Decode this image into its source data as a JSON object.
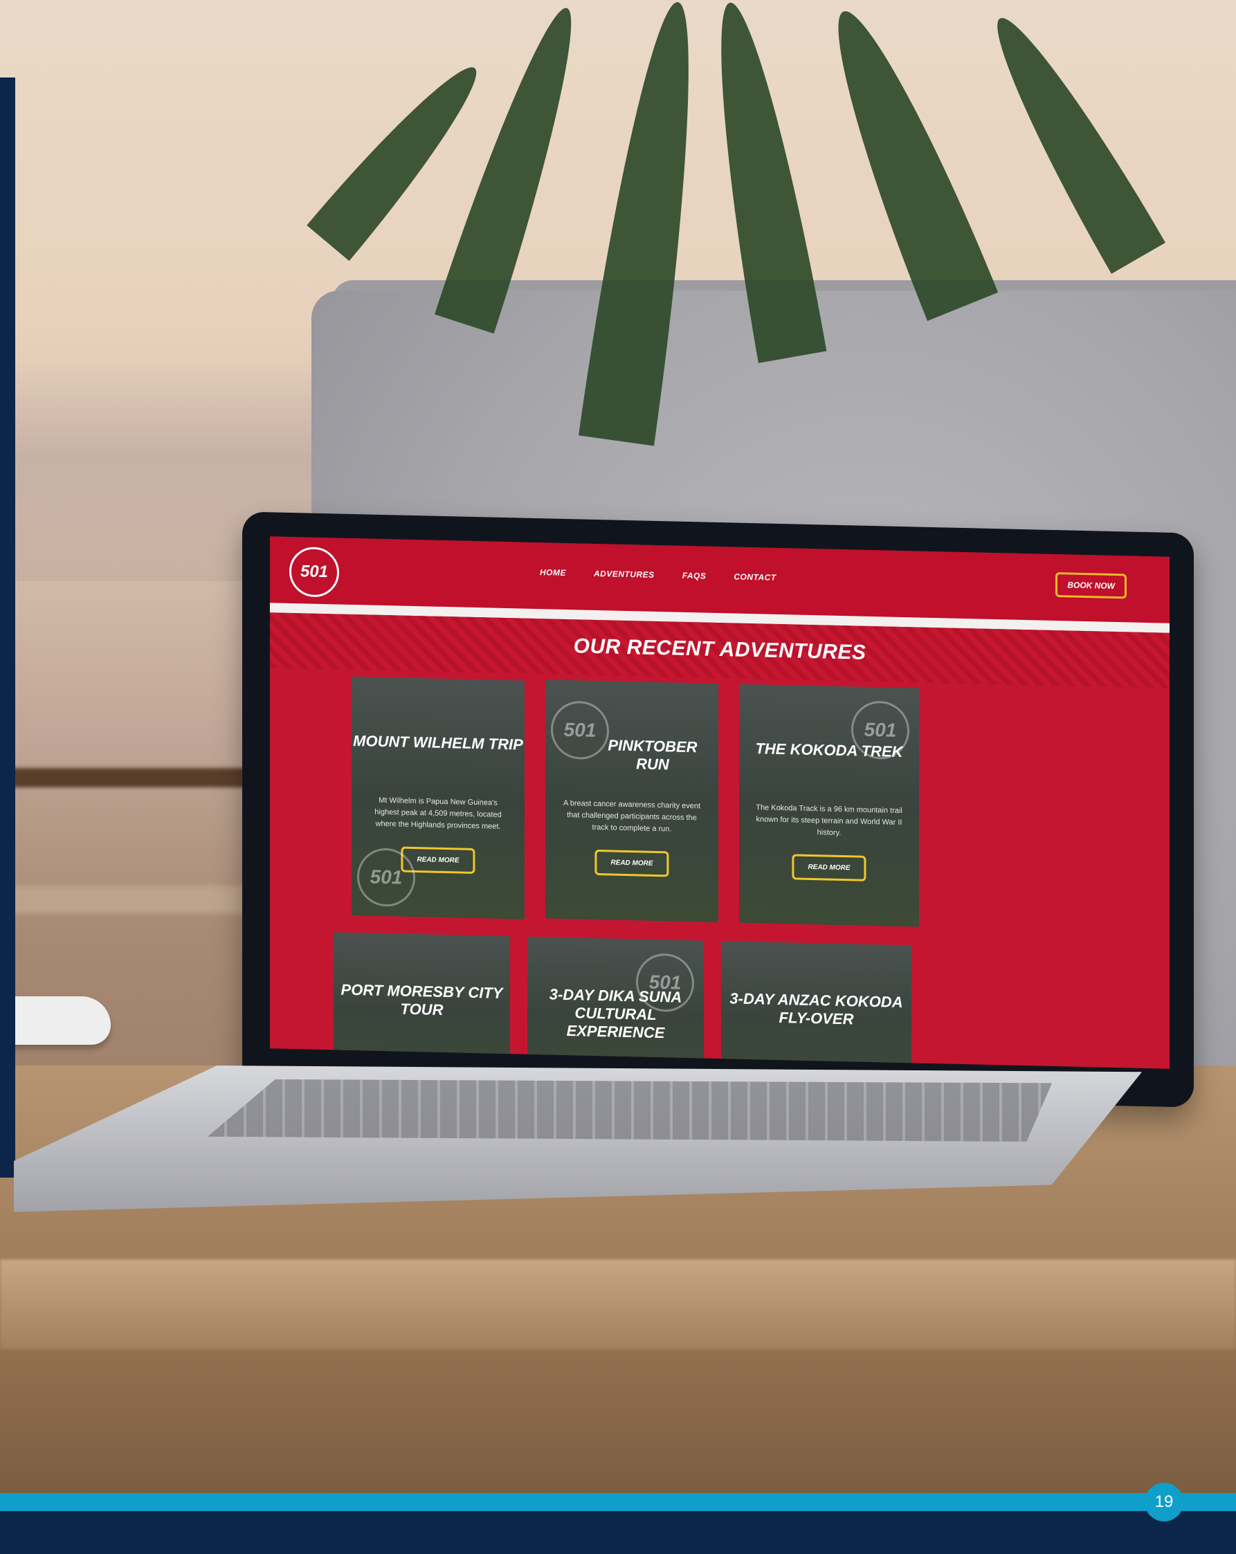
{
  "website": {
    "logo_text": "501",
    "nav": [
      "HOME",
      "ADVENTURES",
      "FAQS",
      "CONTACT"
    ],
    "book_button": "BOOK NOW",
    "section_title": "OUR RECENT ADVENTURES",
    "cards": [
      {
        "title": "MOUNT WILHELM TRIP",
        "description": "Mt Wilhelm is Papua New Guinea's highest peak at 4,509 metres, located where the Highlands provinces meet.",
        "button": "READ MORE"
      },
      {
        "title": "PINKTOBER RUN",
        "description": "A breast cancer awareness charity event that challenged participants across the track to complete a run.",
        "button": "READ MORE"
      },
      {
        "title": "THE KOKODA TREK",
        "description": "The Kokoda Track is a 96 km mountain trail known for its steep terrain and World War II history.",
        "button": "READ MORE"
      },
      {
        "title": "PORT MORESBY CITY TOUR"
      },
      {
        "title": "3-DAY DIKA SUNA CULTURAL EXPERIENCE"
      },
      {
        "title": "3-DAY ANZAC KOKODA FLY-OVER"
      }
    ]
  },
  "page_number": "19"
}
